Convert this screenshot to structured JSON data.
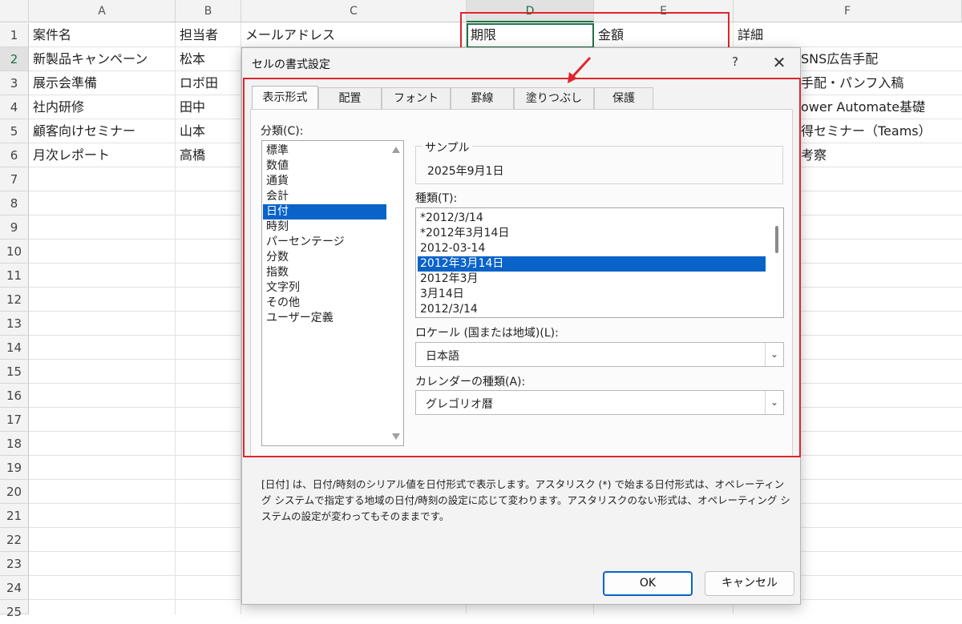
{
  "sheet": {
    "columns": [
      "A",
      "B",
      "C",
      "D",
      "E",
      "F"
    ],
    "rows": [
      "1",
      "2",
      "3",
      "4",
      "5",
      "6",
      "7",
      "8",
      "9",
      "10",
      "11",
      "12",
      "13",
      "14",
      "15",
      "16",
      "17",
      "18",
      "19",
      "20",
      "21",
      "22",
      "23",
      "24",
      "25"
    ],
    "cells": {
      "A1": "案件名",
      "B1": "担当者",
      "C1": "メールアドレス",
      "D1": "期限",
      "E1": "金額",
      "F1": "詳細",
      "A2": "新製品キャンペーン",
      "B2": "松本",
      "F2": "SNS広告手配",
      "A3": "展示会準備",
      "B3": "ロボ田",
      "F3": "手配・パンフ入稿",
      "A4": "社内研修",
      "B4": "田中",
      "F4": "ower Automate基礎",
      "A5": "顧客向けセミナー",
      "B5": "山本",
      "F5": "得セミナー（Teams）",
      "A6": "月次レポート",
      "B6": "高橋",
      "F6": "考察"
    }
  },
  "dialog": {
    "title": "セルの書式設定",
    "help": "?",
    "close": "✕",
    "tabs": [
      "表示形式",
      "配置",
      "フォント",
      "罫線",
      "塗りつぶし",
      "保護"
    ],
    "category_label": "分類(C):",
    "categories": [
      "標準",
      "数値",
      "通貨",
      "会計",
      "日付",
      "時刻",
      "パーセンテージ",
      "分数",
      "指数",
      "文字列",
      "その他",
      "ユーザー定義"
    ],
    "selected_category": "日付",
    "sample_label": "サンプル",
    "sample_value": "2025年9月1日",
    "type_label": "種類(T):",
    "types": [
      "*2012/3/14",
      "*2012年3月14日",
      "2012-03-14",
      "2012年3月14日",
      "2012年3月",
      "3月14日",
      "2012/3/14"
    ],
    "selected_type": "2012年3月14日",
    "locale_label": "ロケール (国または地域)(L):",
    "locale_value": "日本語",
    "calendar_label": "カレンダーの種類(A):",
    "calendar_value": "グレゴリオ暦",
    "description": "[日付] は、日付/時刻のシリアル値を日付形式で表示します。アスタリスク (*) で始まる日付形式は、オペレーティング システムで指定する地域の日付/時刻の設定に応じて変わります。アスタリスクのない形式は、オペレーティング システムの設定が変わってもそのままです。",
    "ok_label": "OK",
    "cancel_label": "キャンセル"
  },
  "colors": {
    "excel_green": "#217346",
    "highlight_red": "#e0252d",
    "selection_blue": "#0a63c9"
  }
}
